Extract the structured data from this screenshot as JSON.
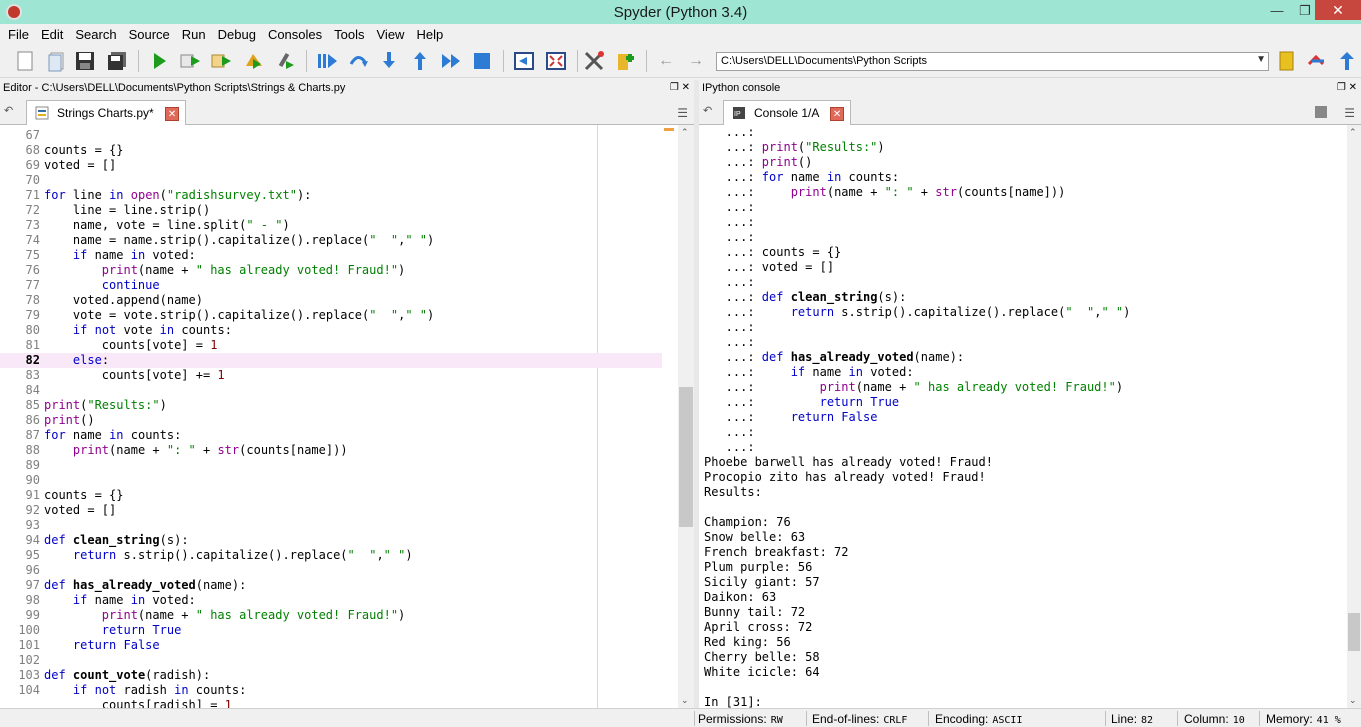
{
  "window": {
    "title": "Spyder (Python 3.4)"
  },
  "menu": [
    "File",
    "Edit",
    "Search",
    "Source",
    "Run",
    "Debug",
    "Consoles",
    "Tools",
    "View",
    "Help"
  ],
  "toolbar": {
    "working_dir": "C:\\Users\\DELL\\Documents\\Python Scripts",
    "icons": [
      "new-file",
      "open-file",
      "save",
      "save-all",
      "run",
      "run-config",
      "run-again",
      "run-selection",
      "debug",
      "debug-continue",
      "step",
      "step-into",
      "step-return",
      "continue",
      "stop",
      "maximize-pane",
      "fullscreen",
      "preferences",
      "python-path",
      "back",
      "forward",
      "browse-folder",
      "set-working-dir",
      "parent-dir"
    ]
  },
  "editor": {
    "header": "Editor - C:\\Users\\DELL\\Documents\\Python Scripts\\Strings & Charts.py",
    "tab_label": "Strings  Charts.py*",
    "current_line": "82",
    "lines": [
      {
        "n": "67",
        "t": ""
      },
      {
        "n": "68",
        "t": "counts = {}"
      },
      {
        "n": "69",
        "t": "voted = []"
      },
      {
        "n": "70",
        "t": ""
      },
      {
        "n": "71",
        "t": "for line in open(\"radishsurvey.txt\"):"
      },
      {
        "n": "72",
        "t": "    line = line.strip()"
      },
      {
        "n": "73",
        "t": "    name, vote = line.split(\" - \")"
      },
      {
        "n": "74",
        "t": "    name = name.strip().capitalize().replace(\"  \",\" \")"
      },
      {
        "n": "75",
        "t": "    if name in voted:"
      },
      {
        "n": "76",
        "t": "        print(name + \" has already voted! Fraud!\")"
      },
      {
        "n": "77",
        "t": "        continue"
      },
      {
        "n": "78",
        "t": "    voted.append(name)"
      },
      {
        "n": "79",
        "t": "    vote = vote.strip().capitalize().replace(\"  \",\" \")"
      },
      {
        "n": "80",
        "t": "    if not vote in counts:"
      },
      {
        "n": "81",
        "t": "        counts[vote] = 1"
      },
      {
        "n": "82",
        "t": "    else:"
      },
      {
        "n": "83",
        "t": "        counts[vote] += 1"
      },
      {
        "n": "84",
        "t": ""
      },
      {
        "n": "85",
        "t": "print(\"Results:\")"
      },
      {
        "n": "86",
        "t": "print()"
      },
      {
        "n": "87",
        "t": "for name in counts:"
      },
      {
        "n": "88",
        "t": "    print(name + \": \" + str(counts[name]))"
      },
      {
        "n": "89",
        "t": ""
      },
      {
        "n": "90",
        "t": ""
      },
      {
        "n": "91",
        "t": "counts = {}"
      },
      {
        "n": "92",
        "t": "voted = []"
      },
      {
        "n": "93",
        "t": ""
      },
      {
        "n": "94",
        "t": "def clean_string(s):"
      },
      {
        "n": "95",
        "t": "    return s.strip().capitalize().replace(\"  \",\" \")"
      },
      {
        "n": "96",
        "t": ""
      },
      {
        "n": "97",
        "t": "def has_already_voted(name):"
      },
      {
        "n": "98",
        "t": "    if name in voted:"
      },
      {
        "n": "99",
        "t": "        print(name + \" has already voted! Fraud!\")"
      },
      {
        "n": "100",
        "t": "        return True"
      },
      {
        "n": "101",
        "t": "    return False"
      },
      {
        "n": "102",
        "t": ""
      },
      {
        "n": "103",
        "t": "def count_vote(radish):"
      },
      {
        "n": "104",
        "t": "    if not radish in counts:"
      },
      {
        "n": "",
        "t": "        counts[radish] = 1"
      }
    ]
  },
  "console": {
    "header": "IPython console",
    "tab_label": "Console 1/A",
    "lines": [
      "   ...:",
      "   ...: print(\"Results:\")",
      "   ...: print()",
      "   ...: for name in counts:",
      "   ...:     print(name + \": \" + str(counts[name]))",
      "   ...:",
      "   ...:",
      "   ...:",
      "   ...: counts = {}",
      "   ...: voted = []",
      "   ...:",
      "   ...: def clean_string(s):",
      "   ...:     return s.strip().capitalize().replace(\"  \",\" \")",
      "   ...:",
      "   ...:",
      "   ...: def has_already_voted(name):",
      "   ...:     if name in voted:",
      "   ...:         print(name + \" has already voted! Fraud!\")",
      "   ...:         return True",
      "   ...:     return False",
      "   ...:",
      "   ...:",
      "Phoebe barwell has already voted! Fraud!",
      "Procopio zito has already voted! Fraud!",
      "Results:",
      "",
      "Champion: 76",
      "Snow belle: 63",
      "French breakfast: 72",
      "Plum purple: 56",
      "Sicily giant: 57",
      "Daikon: 63",
      "Bunny tail: 72",
      "April cross: 72",
      "Red king: 56",
      "Cherry belle: 58",
      "White icicle: 64",
      "",
      "In [31]:"
    ]
  },
  "status": {
    "permissions_label": "Permissions:",
    "permissions": "RW",
    "eol_label": "End-of-lines:",
    "eol": "CRLF",
    "encoding_label": "Encoding:",
    "encoding": "ASCII",
    "line_label": "Line:",
    "line": "82",
    "column_label": "Column:",
    "column": "10",
    "memory_label": "Memory:",
    "memory": "41 %"
  }
}
